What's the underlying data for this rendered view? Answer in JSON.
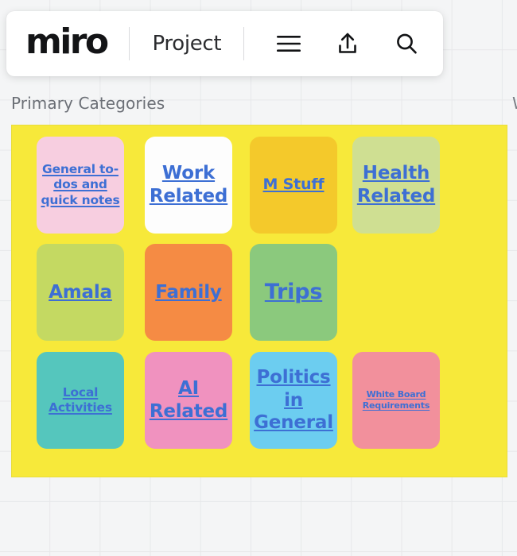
{
  "app": {
    "name": "miro",
    "logo_text": "miro"
  },
  "toolbar": {
    "logo_label": "miro",
    "project_label": "Project",
    "menu_icon": "hamburger-menu-icon",
    "share_icon": "share-upload-icon",
    "search_icon": "search-icon"
  },
  "canvas": {
    "grid": true,
    "grid_size_px": 63,
    "background_color": "#f4f5f6",
    "grid_line_color": "#e7e8ea"
  },
  "frame": {
    "title": "Primary Categories",
    "title_partial_right": "W",
    "background_color": "#f7e93a",
    "border_color": "#e9dc3a"
  },
  "notes": [
    {
      "label": "General to-\ndos and \nquick notes",
      "color": "#f7cee0",
      "size": "sm",
      "row": 1,
      "col": 1
    },
    {
      "label": "Work \nRelated",
      "color": "#fdfdfd",
      "size": "lg",
      "row": 1,
      "col": 2
    },
    {
      "label": "M Stuff",
      "color": "#f4c92b",
      "size": "md",
      "row": 1,
      "col": 3
    },
    {
      "label": "Health \nRelated",
      "color": "#cfdf92",
      "size": "lg",
      "row": 1,
      "col": 4
    },
    {
      "label": "Amala",
      "color": "#c4d962",
      "size": "lg",
      "row": 2,
      "col": 1
    },
    {
      "label": "Family",
      "color": "#f58b44",
      "size": "lg",
      "row": 2,
      "col": 2
    },
    {
      "label": "Trips",
      "color": "#8bc97d",
      "size": "xl",
      "row": 2,
      "col": 3
    },
    {
      "label": "Local \nActivities",
      "color": "#55c6bd",
      "size": "sm",
      "row": 3,
      "col": 1
    },
    {
      "label": "AI \nRelated",
      "color": "#f092bf",
      "size": "lg",
      "row": 3,
      "col": 2
    },
    {
      "label": "Politics \nin \nGeneral",
      "color": "#6ccdf0",
      "size": "lg",
      "row": 3,
      "col": 3
    },
    {
      "label": "White Board \nRequirements",
      "color": "#f2909c",
      "size": "xs",
      "row": 3,
      "col": 4
    }
  ],
  "colors": {
    "link_text": "#3d6fd4",
    "frame_yellow": "#f7e93a",
    "title_gray": "#6b6f76"
  }
}
